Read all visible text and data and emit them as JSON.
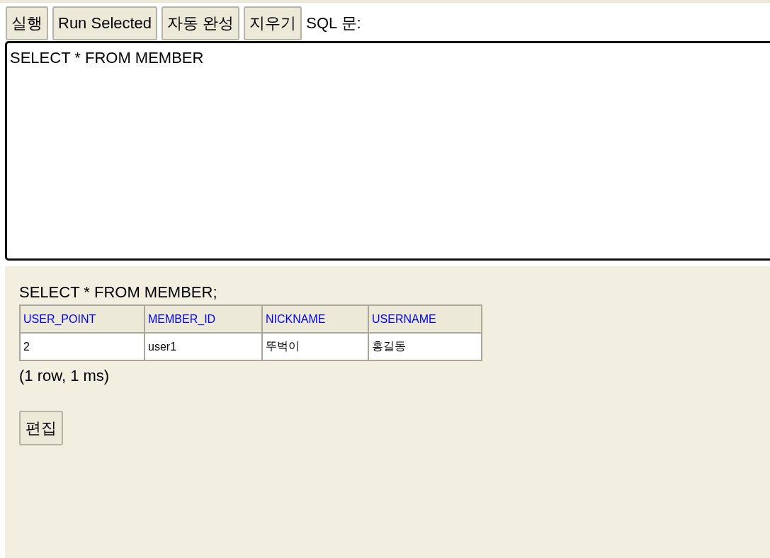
{
  "toolbar": {
    "buttons": [
      "실행",
      "Run Selected",
      "자동 완성",
      "지우기"
    ],
    "label": "SQL 문:"
  },
  "editor": {
    "value": "SELECT * FROM MEMBER"
  },
  "result": {
    "statement": "SELECT * FROM MEMBER;",
    "table": {
      "columns": [
        "USER_POINT",
        "MEMBER_ID",
        "NICKNAME",
        "USERNAME"
      ],
      "rows": [
        [
          "2",
          "user1",
          "뚜벅이",
          "홍길동"
        ]
      ]
    },
    "status": "(1 row, 1 ms)",
    "edit_button": "편집"
  }
}
